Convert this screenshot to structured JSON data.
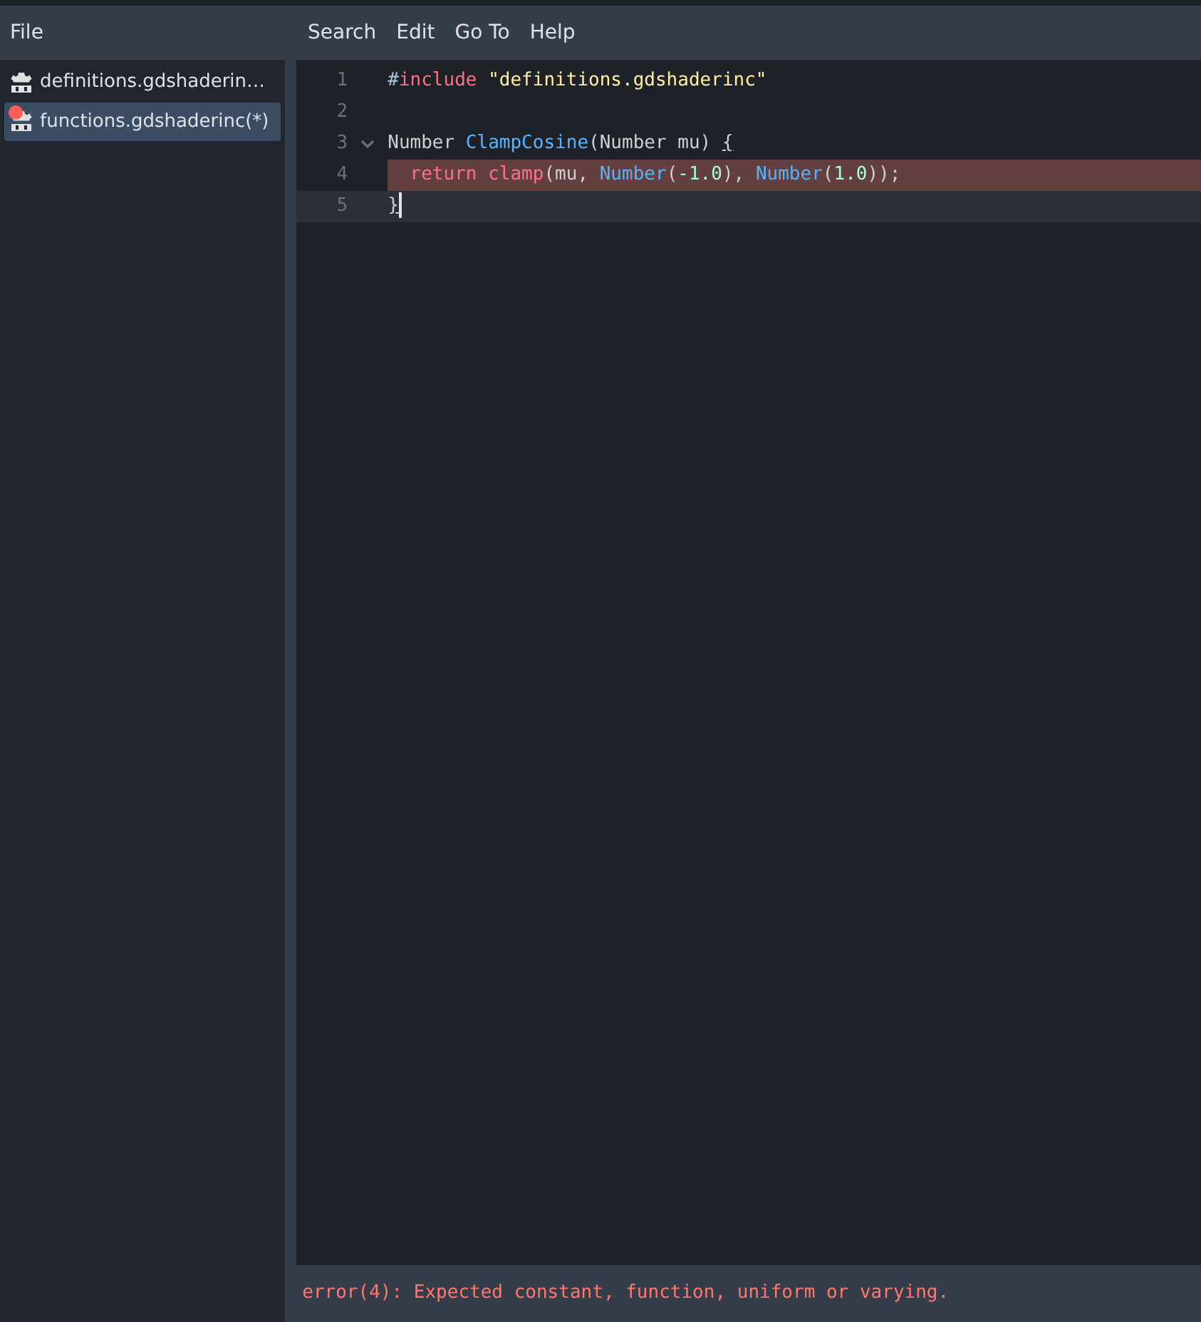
{
  "menu_left": [
    "File"
  ],
  "menu": [
    "Search",
    "Edit",
    "Go To",
    "Help"
  ],
  "files": [
    {
      "name": "definitions.gdshaderin…",
      "selected": false,
      "error": false
    },
    {
      "name": "functions.gdshaderinc(*)",
      "selected": true,
      "error": true
    }
  ],
  "lines": [
    {
      "number": "1",
      "error": false,
      "current": false,
      "foldable": false,
      "caret": false,
      "tokens": [
        {
          "kind": "punct",
          "text": "#"
        },
        {
          "kind": "keyword",
          "text": "include "
        },
        {
          "kind": "string",
          "text": "\"definitions.gdshaderinc\""
        }
      ]
    },
    {
      "number": "2",
      "error": false,
      "current": false,
      "foldable": false,
      "caret": false
    },
    {
      "number": "3",
      "error": false,
      "current": false,
      "foldable": true,
      "caret": false,
      "tokens": [
        {
          "kind": "plain",
          "text": "Number "
        },
        {
          "kind": "function",
          "text": "ClampCosine"
        },
        {
          "kind": "plain",
          "text": "(Number mu) "
        },
        {
          "kind": "bracket",
          "text": "{"
        }
      ]
    },
    {
      "number": "4",
      "error": true,
      "current": false,
      "foldable": false,
      "caret": false,
      "tokens": [
        {
          "kind": "keyword",
          "text": "  return "
        },
        {
          "kind": "builtin",
          "text": "clamp"
        },
        {
          "kind": "plain",
          "text": "(mu, "
        },
        {
          "kind": "function",
          "text": "Number"
        },
        {
          "kind": "plain",
          "text": "("
        },
        {
          "kind": "number",
          "text": "-1.0"
        },
        {
          "kind": "plain",
          "text": "), "
        },
        {
          "kind": "function",
          "text": "Number"
        },
        {
          "kind": "plain",
          "text": "("
        },
        {
          "kind": "number",
          "text": "1.0"
        },
        {
          "kind": "plain",
          "text": "));"
        }
      ]
    },
    {
      "number": "5",
      "error": false,
      "current": true,
      "foldable": false,
      "caret": true,
      "tokens": [
        {
          "kind": "bracket",
          "text": "}"
        }
      ]
    }
  ],
  "status": {
    "kind": "error",
    "text": "error(4): Expected constant, function, uniform or varying."
  }
}
